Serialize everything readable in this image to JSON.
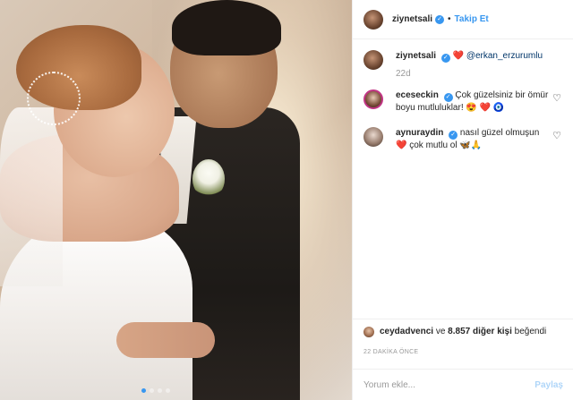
{
  "post": {
    "author": "ziynetsali",
    "follow_separator": "•",
    "follow_label": "Takip Et",
    "carousel": {
      "count": 4,
      "active_index": 0
    },
    "caption": {
      "username": "ziynetsali",
      "emoji": "❤️",
      "mention": "@erkan_erzurumlu",
      "time": "22d"
    },
    "comments": [
      {
        "username": "eceseckin",
        "text": "Çok güzelsiniz bir ömür boyu mutluluklar!",
        "emojis": "😍 ❤️ 🧿"
      },
      {
        "username": "aynuraydin",
        "text": "nasıl güzel olmuşun",
        "text2": "çok mutlu ol",
        "emoji_pre": "❤️",
        "emojis": "🦋🙏"
      }
    ],
    "likes": {
      "username": "ceydadvenci",
      "connector": "ve",
      "count_text": "8.857 diğer kişi",
      "suffix": "beğendi"
    },
    "timestamp": "22 DAKİKA ÖNCE",
    "comment_input": {
      "placeholder": "Yorum ekle...",
      "submit_label": "Paylaş"
    }
  }
}
